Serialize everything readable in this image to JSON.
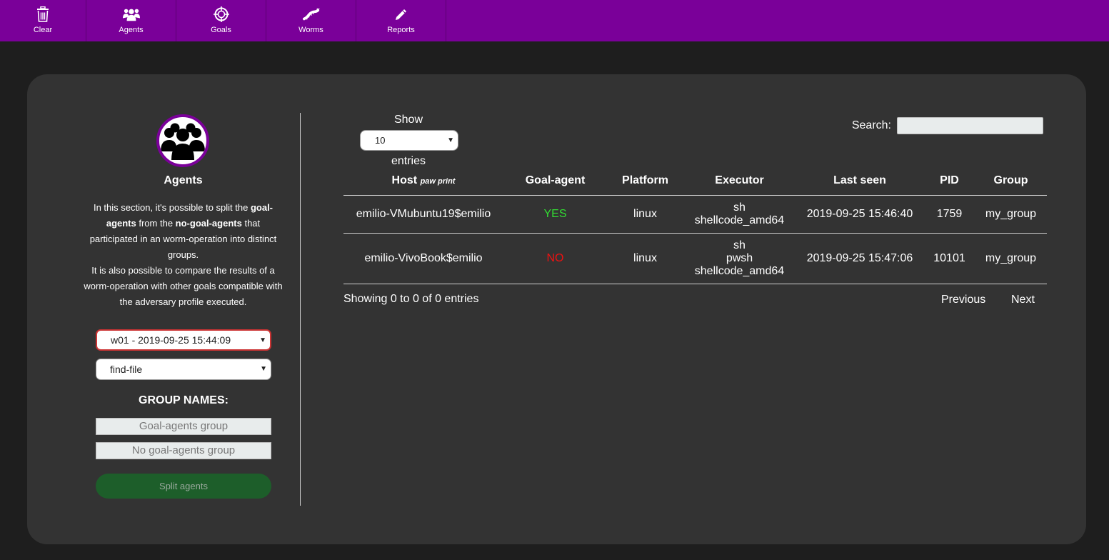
{
  "nav": {
    "items": [
      {
        "label": "Clear",
        "icon": "trash-icon"
      },
      {
        "label": "Agents",
        "icon": "users-icon"
      },
      {
        "label": "Goals",
        "icon": "crosshair-icon"
      },
      {
        "label": "Worms",
        "icon": "worm-icon"
      },
      {
        "label": "Reports",
        "icon": "pencil-icon"
      }
    ]
  },
  "colors": {
    "nav_bg": "#7a0099",
    "yes": "#33dd33",
    "no": "#ee1111",
    "split_button": "#1d5e2a"
  },
  "sidebar": {
    "title": "Agents",
    "desc": {
      "p1_a": "In this section, it's possible to split the ",
      "p1_b": "goal-agents",
      "p1_c": " from the ",
      "p1_d": "no-goal-agents",
      "p1_e": " that participated in an worm-operation into distinct groups.",
      "p2": "It is also possible to compare the results of a worm-operation with other goals compatible with the adversary profile executed."
    },
    "operation_select": "w01 - 2019-09-25 15:44:09",
    "goal_select": "find-file",
    "group_names_title": "GROUP NAMES:",
    "goal_group_placeholder": "Goal-agents group",
    "no_goal_group_placeholder": "No goal-agents group",
    "split_button": "Split agents"
  },
  "table": {
    "show_label": "Show",
    "page_size": "10",
    "entries_label": "entries",
    "search_label": "Search:",
    "search_value": "",
    "headers": {
      "host": "Host",
      "host_sub": "paw print",
      "goal_agent": "Goal-agent",
      "platform": "Platform",
      "executor": "Executor",
      "last_seen": "Last seen",
      "pid": "PID",
      "group": "Group"
    },
    "rows": [
      {
        "host": "emilio-VMubuntu19$emilio",
        "goal_agent": "YES",
        "platform": "linux",
        "executor": [
          "sh",
          "shellcode_amd64"
        ],
        "last_seen": "2019-09-25 15:46:40",
        "pid": "1759",
        "group": "my_group"
      },
      {
        "host": "emilio-VivoBook$emilio",
        "goal_agent": "NO",
        "platform": "linux",
        "executor": [
          "sh",
          "pwsh",
          "shellcode_amd64"
        ],
        "last_seen": "2019-09-25 15:47:06",
        "pid": "10101",
        "group": "my_group"
      }
    ],
    "info": "Showing 0 to 0 of 0 entries",
    "previous": "Previous",
    "next": "Next"
  }
}
